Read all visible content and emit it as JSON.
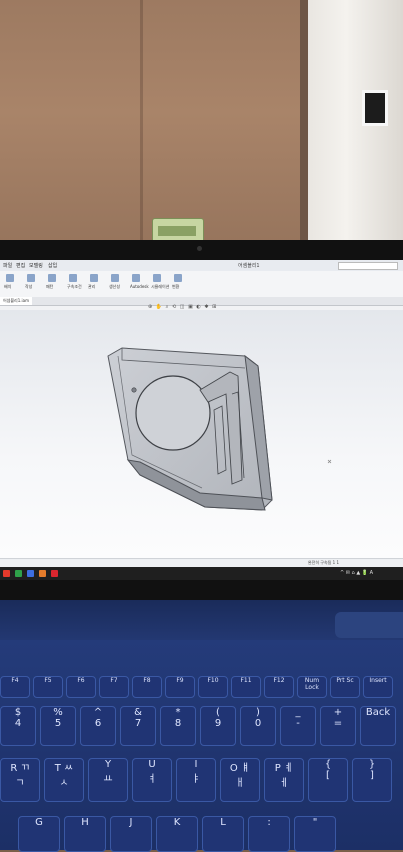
{
  "app": {
    "menus": [
      "파일",
      "편집",
      "모델링",
      "삽입"
    ],
    "window_title": "어셈블리1",
    "tab": "어셈블리1.iam",
    "ribbon": [
      {
        "label": "배치"
      },
      {
        "label": "작성"
      },
      {
        "label": "패턴"
      },
      {
        "label": "구속조건"
      },
      {
        "label": "관리"
      },
      {
        "label": "생산성"
      },
      {
        "label": "Autodesk"
      },
      {
        "label": "시뮬레이션"
      },
      {
        "label": "변환"
      }
    ],
    "toolbar_glyphs": "⊕ ✋ ⌕ ⟲ ◫ ▣ ◐ ✱ ⊞",
    "statusbar": "완전히 구속됨   1  1",
    "taskbar_icons": [
      {
        "icon": "start-icon",
        "color": "#e53a2c"
      },
      {
        "icon": "app-icon-green",
        "color": "#2fa14a"
      },
      {
        "icon": "app-icon-blue",
        "color": "#3d6ee0"
      },
      {
        "icon": "app-icon-orange",
        "color": "#e57c2c"
      },
      {
        "icon": "inventor-icon",
        "color": "#d9262f"
      }
    ],
    "tray": "^ ✉ ⌂ ▲ 🔋 A"
  },
  "keyboard": {
    "fn_row": [
      {
        "main": "F4"
      },
      {
        "main": "F5"
      },
      {
        "main": "F6"
      },
      {
        "main": "F7"
      },
      {
        "main": "F8"
      },
      {
        "main": "F9"
      },
      {
        "main": "F10"
      },
      {
        "main": "F11"
      },
      {
        "main": "F12"
      },
      {
        "main": "Num Lock"
      },
      {
        "main": "Prt Sc"
      },
      {
        "main": "Insert"
      }
    ],
    "num_row": [
      {
        "top": "$",
        "bottom": "4"
      },
      {
        "top": "%",
        "bottom": "5"
      },
      {
        "top": "^",
        "bottom": "6"
      },
      {
        "top": "&",
        "bottom": "7"
      },
      {
        "top": "*",
        "bottom": "8"
      },
      {
        "top": "(",
        "bottom": "9"
      },
      {
        "top": ")",
        "bottom": "0"
      },
      {
        "top": "_",
        "bottom": "-"
      },
      {
        "top": "+",
        "bottom": "="
      },
      {
        "top": "Back",
        "bottom": ""
      }
    ],
    "top_row": [
      {
        "top": "R ㄲ",
        "bottom": "ㄱ"
      },
      {
        "top": "T ㅆ",
        "bottom": "ㅅ"
      },
      {
        "top": "Y",
        "bottom": "ㅛ"
      },
      {
        "top": "U",
        "bottom": "ㅕ"
      },
      {
        "top": "I",
        "bottom": "ㅑ"
      },
      {
        "top": "O ㅒ",
        "bottom": "ㅐ"
      },
      {
        "top": "P ㅖ",
        "bottom": "ㅔ"
      },
      {
        "top": "{",
        "bottom": "["
      },
      {
        "top": "}",
        "bottom": "]"
      }
    ],
    "home_row": [
      {
        "top": "G",
        "bottom": ""
      },
      {
        "top": "H",
        "bottom": ""
      },
      {
        "top": "J",
        "bottom": ""
      },
      {
        "top": "K",
        "bottom": ""
      },
      {
        "top": "L",
        "bottom": ""
      },
      {
        "top": ":",
        "bottom": ""
      },
      {
        "top": "\"",
        "bottom": ""
      }
    ]
  },
  "colors": {
    "keyboard": "#203474",
    "part_fill": "#b9bcc2",
    "part_edge": "#55585e"
  }
}
